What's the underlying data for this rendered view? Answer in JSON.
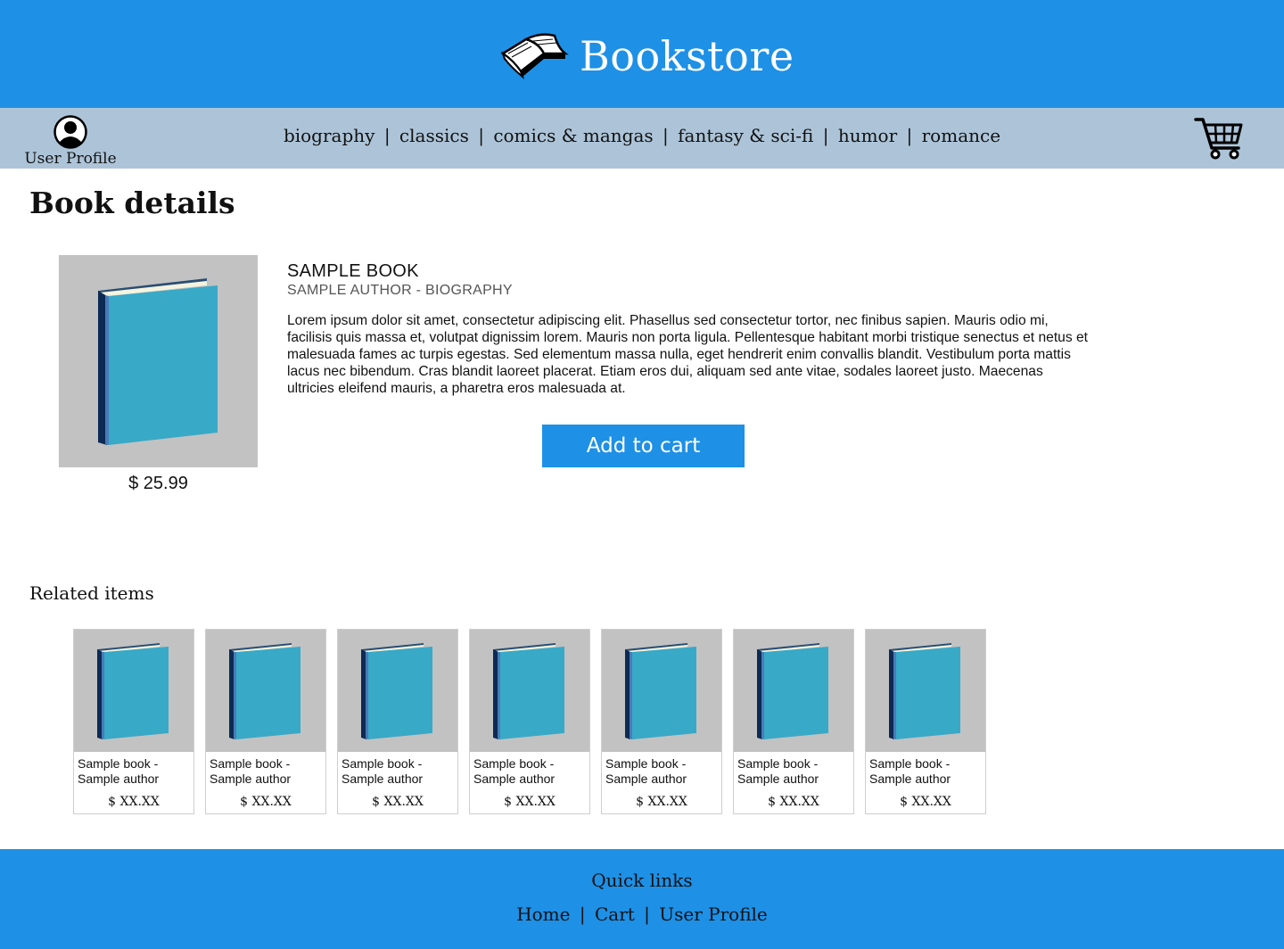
{
  "header": {
    "title": "Bookstore",
    "logo_icon": "open-book-icon"
  },
  "nav": {
    "profile_label": "User Profile",
    "profile_icon": "user-avatar-icon",
    "categories": [
      "biography",
      "classics",
      "comics & mangas",
      "fantasy & sci-fi",
      "humor",
      "romance"
    ],
    "separator": "|",
    "cart_icon": "shopping-cart-icon"
  },
  "main": {
    "page_title": "Book details",
    "book": {
      "title": "SAMPLE BOOK",
      "subtitle": "SAMPLE AUTHOR - BIOGRAPHY",
      "description": "Lorem ipsum dolor sit amet, consectetur adipiscing elit. Phasellus sed consectetur tortor, nec finibus sapien. Mauris odio mi, facilisis quis massa et, volutpat dignissim lorem. Mauris non porta ligula. Pellentesque habitant morbi tristique senectus et netus et malesuada fames ac turpis egestas. Sed elementum massa nulla, eget hendrerit enim convallis blandit. Vestibulum porta mattis lacus nec bibendum. Cras blandit laoreet placerat. Etiam eros dui, aliquam sed ante vitae, sodales laoreet justo. Maecenas ultricies eleifend mauris, a pharetra eros malesuada at.",
      "price": "$ 25.99",
      "cover_icon": "book-cover-icon"
    },
    "add_to_cart_label": "Add to cart"
  },
  "related": {
    "title": "Related items",
    "items": [
      {
        "name_line1": "Sample book -",
        "name_line2": "Sample author",
        "price": "$ XX.XX"
      },
      {
        "name_line1": "Sample book -",
        "name_line2": "Sample author",
        "price": "$ XX.XX"
      },
      {
        "name_line1": "Sample book -",
        "name_line2": "Sample author",
        "price": "$ XX.XX"
      },
      {
        "name_line1": "Sample book -",
        "name_line2": "Sample author",
        "price": "$ XX.XX"
      },
      {
        "name_line1": "Sample book -",
        "name_line2": "Sample author",
        "price": "$ XX.XX"
      },
      {
        "name_line1": "Sample book -",
        "name_line2": "Sample author",
        "price": "$ XX.XX"
      },
      {
        "name_line1": "Sample book -",
        "name_line2": "Sample author",
        "price": "$ XX.XX"
      }
    ]
  },
  "footer": {
    "title": "Quick links",
    "links": [
      "Home",
      "Cart",
      "User Profile"
    ],
    "separator": "|"
  },
  "colors": {
    "primary_blue": "#1e90e6",
    "nav_background": "#adc4d8",
    "cover_background": "#c2c2c2",
    "book_blue": "#38a9c7",
    "book_spine": "#0c2a54"
  }
}
